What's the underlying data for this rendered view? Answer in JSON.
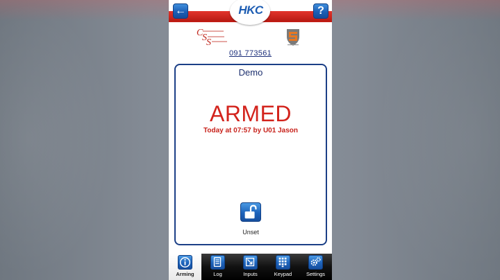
{
  "header": {
    "back_label": "←",
    "help_label": "?",
    "logo_text": "HKC"
  },
  "installer": {
    "logo_letters": [
      "C",
      "S",
      "S"
    ],
    "phone": "091 773561"
  },
  "panel": {
    "name": "Demo",
    "status": "ARMED",
    "status_detail": "Today at 07:57 by U01 Jason",
    "action_label": "Unset"
  },
  "tabs": [
    {
      "label": "Arming",
      "icon": "info-icon",
      "active": true
    },
    {
      "label": "Log",
      "icon": "log-icon",
      "active": false
    },
    {
      "label": "Inputs",
      "icon": "inputs-icon",
      "active": false
    },
    {
      "label": "Keypad",
      "icon": "keypad-icon",
      "active": false
    },
    {
      "label": "Settings",
      "icon": "settings-icon",
      "active": false
    }
  ],
  "colors": {
    "brand_red": "#d3231c",
    "brand_blue": "#1d63bb",
    "card_border": "#1b3f86"
  }
}
